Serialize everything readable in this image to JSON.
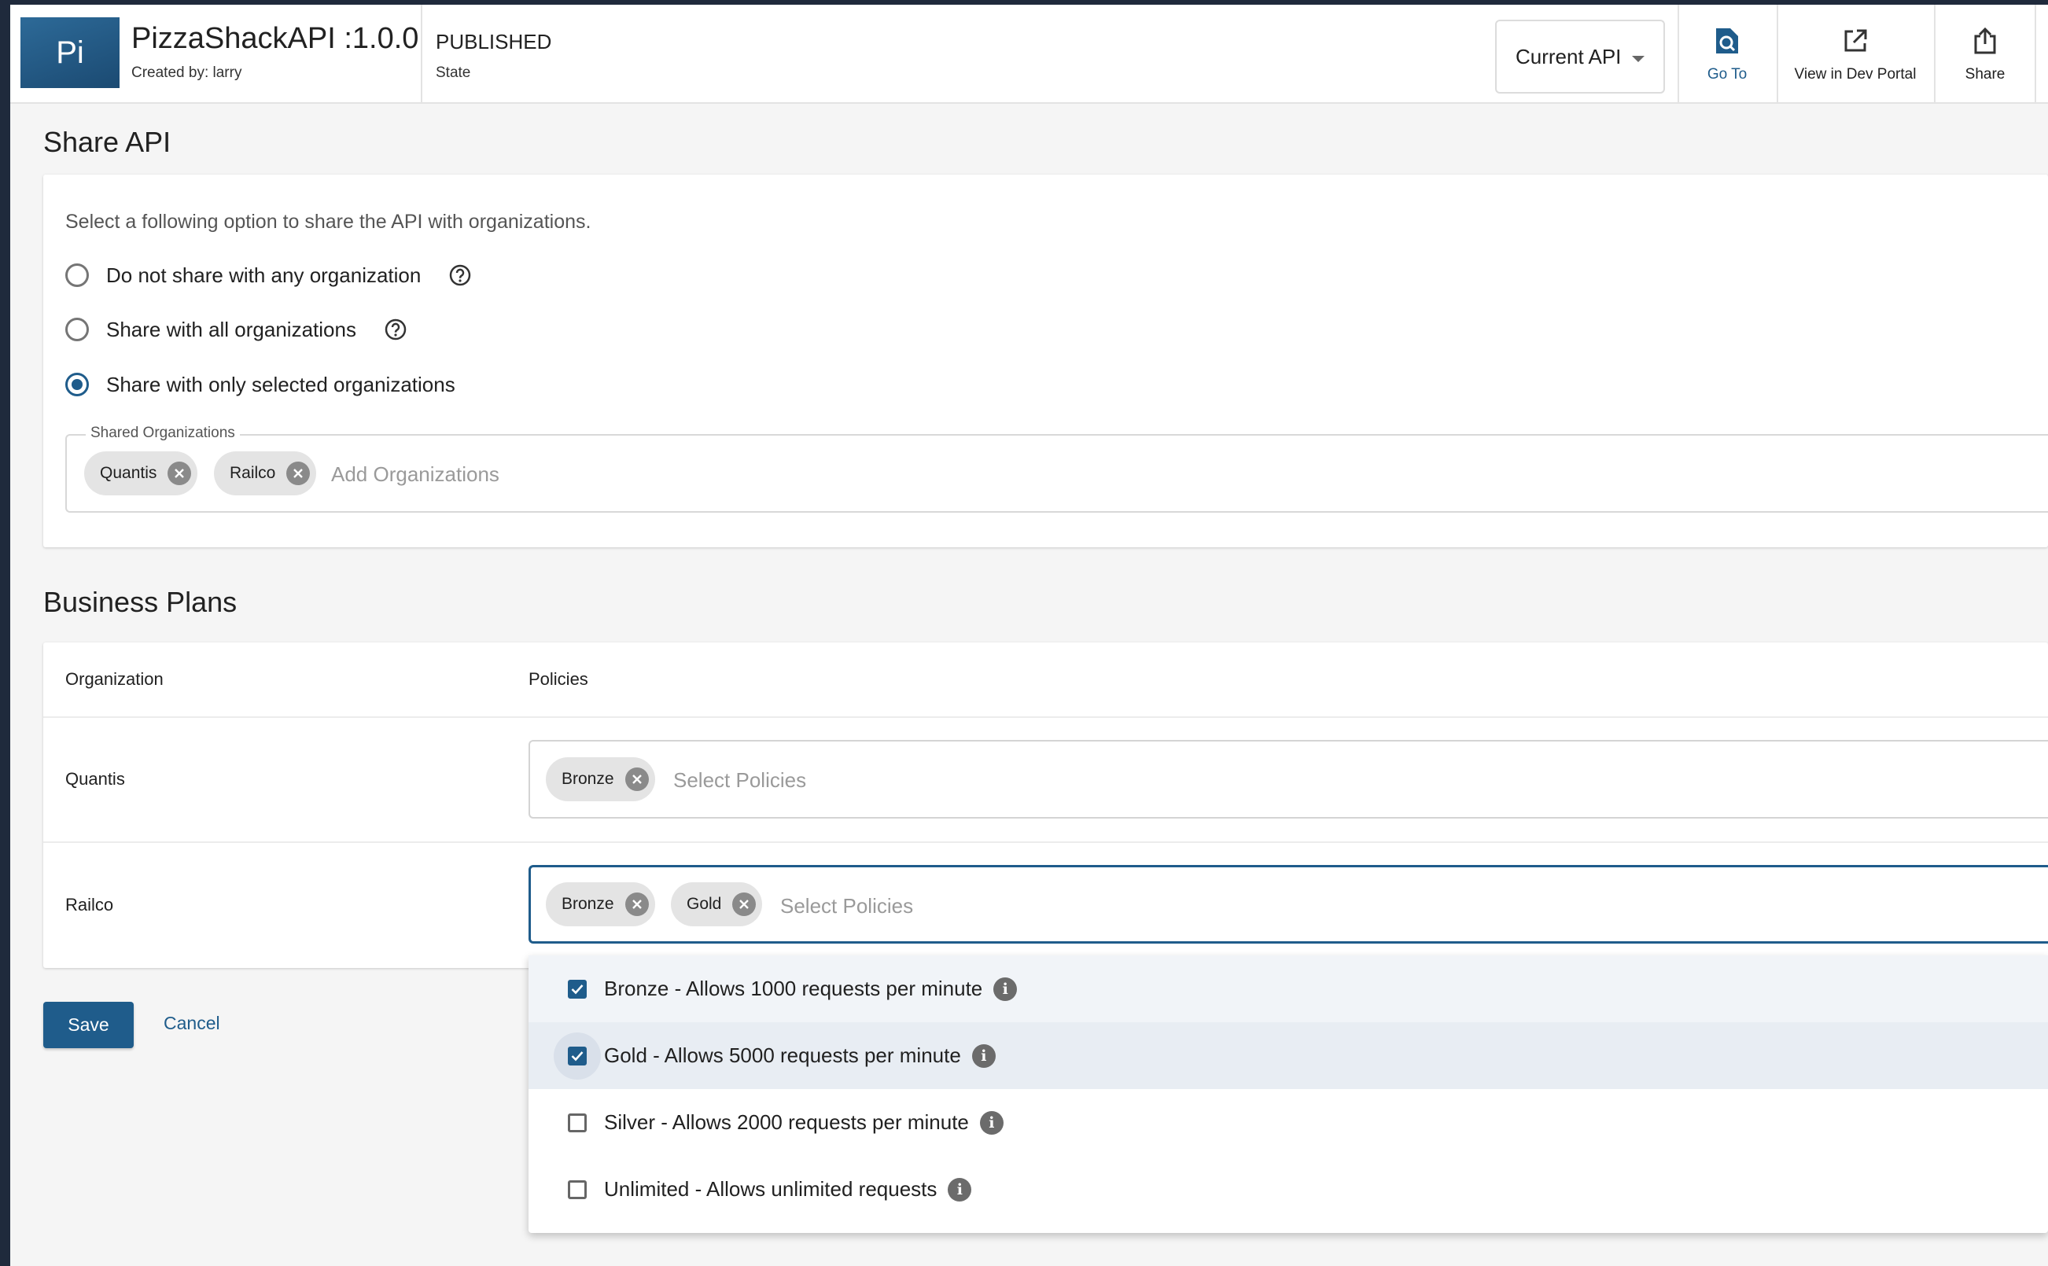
{
  "header": {
    "logo_text": "Pi",
    "api_title": "PizzaShackAPI :1.0.0",
    "created_by": "Created by: larry",
    "state_value": "PUBLISHED",
    "state_label": "State",
    "version_select": "Current API",
    "actions": [
      {
        "label": "Go To",
        "icon": "search-document-icon"
      },
      {
        "label": "View in Dev Portal",
        "icon": "external-link-icon"
      },
      {
        "label": "Share",
        "icon": "share-icon"
      }
    ]
  },
  "share": {
    "title": "Share API",
    "hint": "Select a following option to share the API with organizations.",
    "options": [
      {
        "label": "Do not share with any organization",
        "checked": false
      },
      {
        "label": "Share with all organizations",
        "checked": false
      },
      {
        "label": "Share with only selected organizations",
        "checked": true
      }
    ],
    "shared_orgs_legend": "Shared Organizations",
    "shared_orgs": [
      "Quantis",
      "Railco"
    ],
    "add_placeholder": "Add Organizations"
  },
  "plans": {
    "title": "Business Plans",
    "col_org": "Organization",
    "col_policies": "Policies",
    "rows": [
      {
        "org": "Quantis",
        "policies": [
          "Bronze"
        ],
        "placeholder": "Select Policies"
      },
      {
        "org": "Railco",
        "policies": [
          "Bronze",
          "Gold"
        ],
        "placeholder": "Select Policies"
      }
    ]
  },
  "buttons": {
    "save": "Save",
    "cancel": "Cancel"
  },
  "dropdown": {
    "options": [
      {
        "label": "Bronze - Allows 1000 requests per minute",
        "checked": true
      },
      {
        "label": "Gold - Allows 5000 requests per minute",
        "checked": true
      },
      {
        "label": "Silver - Allows 2000 requests per minute",
        "checked": false
      },
      {
        "label": "Unlimited - Allows unlimited requests",
        "checked": false
      }
    ]
  },
  "colors": {
    "primary": "#1f5c8b",
    "rail": "#1f2a3c"
  }
}
